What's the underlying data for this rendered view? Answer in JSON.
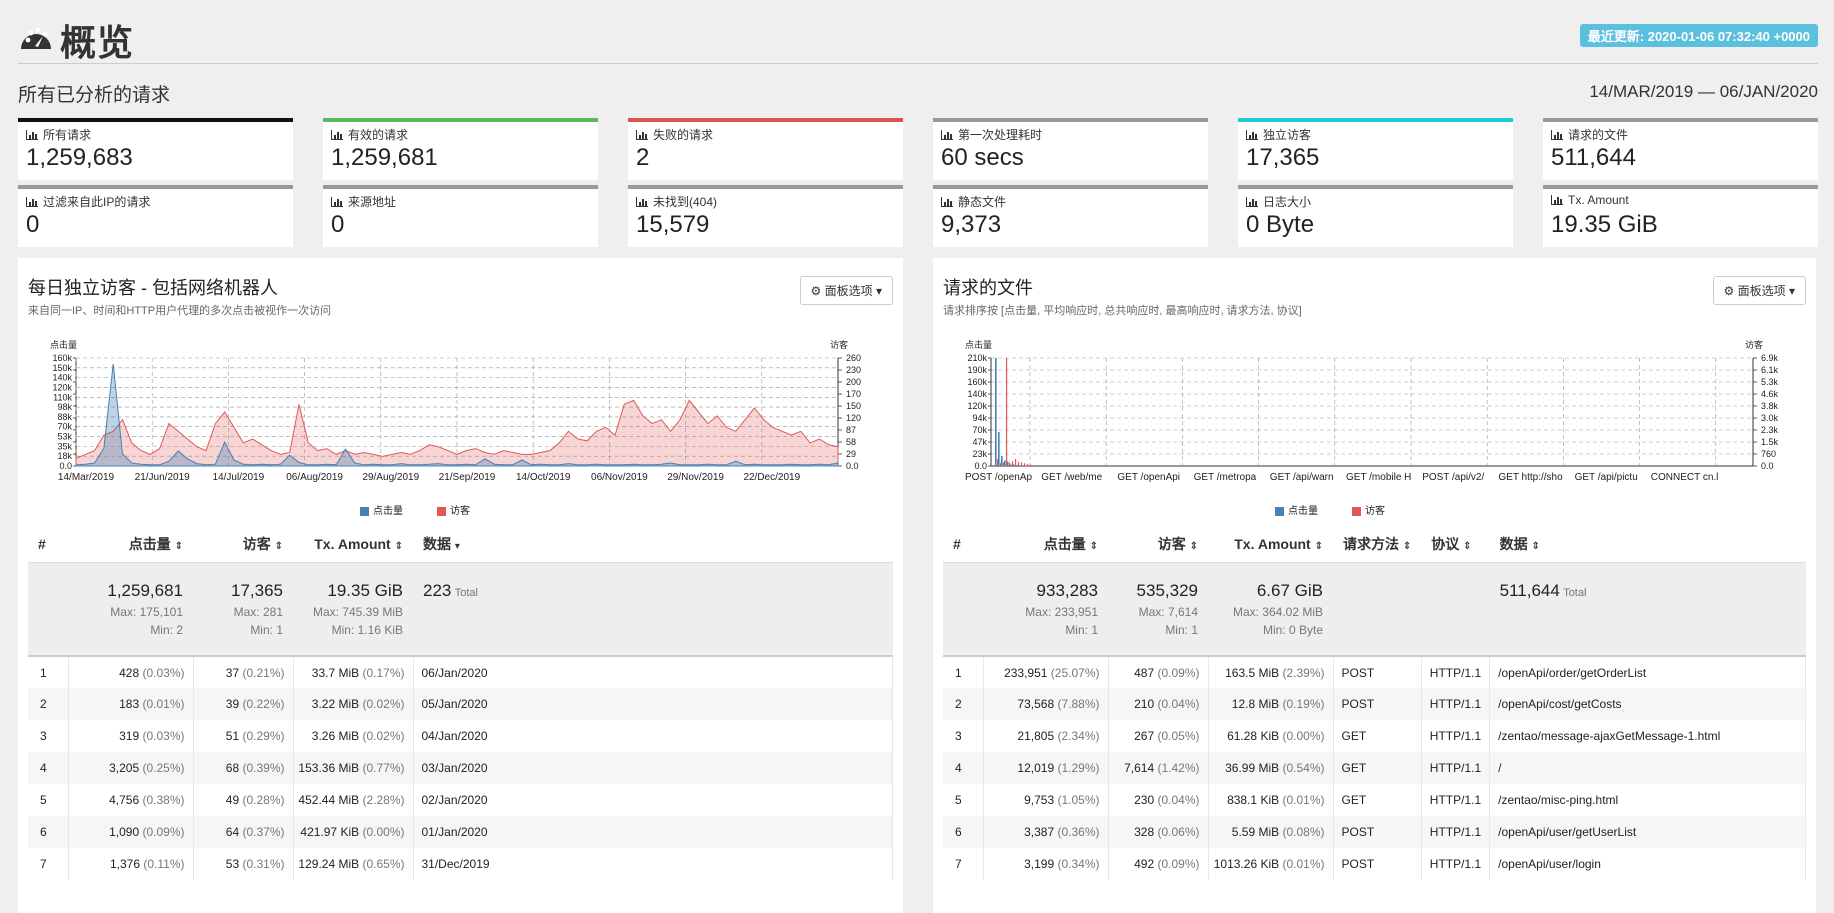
{
  "header": {
    "title": "概览",
    "updated": "最近更新: 2020-01-06 07:32:40 +0000"
  },
  "overview": {
    "subtitle": "所有已分析的请求",
    "daterange": "14/MAR/2019 — 06/JAN/2020"
  },
  "cards": [
    {
      "label": "所有请求",
      "value": "1,259,683",
      "color": "#111111"
    },
    {
      "label": "有效的请求",
      "value": "1,259,681",
      "color": "#5cb85c"
    },
    {
      "label": "失败的请求",
      "value": "2",
      "color": "#d9534f"
    },
    {
      "label": "第一次处理耗时",
      "value": "60 secs",
      "color": "#999999"
    },
    {
      "label": "独立访客",
      "value": "17,365",
      "color": "#1ec9d6"
    },
    {
      "label": "请求的文件",
      "value": "511,644",
      "color": "#999999"
    },
    {
      "label": "过滤来自此IP的请求",
      "value": "0",
      "color": "#999999"
    },
    {
      "label": "来源地址",
      "value": "0",
      "color": "#999999"
    },
    {
      "label": "未找到(404)",
      "value": "15,579",
      "color": "#999999"
    },
    {
      "label": "静态文件",
      "value": "9,373",
      "color": "#999999"
    },
    {
      "label": "日志大小",
      "value": "0 Byte",
      "color": "#999999"
    },
    {
      "label": "Tx. Amount",
      "value": "19.35 GiB",
      "color": "#999999"
    }
  ],
  "panel_left": {
    "title": "每日独立访客 - 包括网络机器人",
    "subtitle": "来自同一IP、时间和HTTP用户代理的多次点击被视作一次访问",
    "options": "面板选项",
    "columns": [
      "#",
      "点击量",
      "访客",
      "Tx. Amount",
      "数据"
    ],
    "totals": {
      "hits": "1,259,681",
      "hits_max": "Max: 175,101",
      "hits_min": "Min: 2",
      "visitors": "17,365",
      "visitors_max": "Max: 281",
      "visitors_min": "Min: 1",
      "tx": "19.35 GiB",
      "tx_max": "Max: 745.39 MiB",
      "tx_min": "Min: 1.16 KiB",
      "data": "223",
      "data_label": "Total"
    },
    "rows": [
      {
        "i": "1",
        "hits": "428",
        "hits_p": "(0.03%)",
        "vis": "37",
        "vis_p": "(0.21%)",
        "tx": "33.7 MiB",
        "tx_p": "(0.17%)",
        "data": "06/Jan/2020"
      },
      {
        "i": "2",
        "hits": "183",
        "hits_p": "(0.01%)",
        "vis": "39",
        "vis_p": "(0.22%)",
        "tx": "3.22 MiB",
        "tx_p": "(0.02%)",
        "data": "05/Jan/2020"
      },
      {
        "i": "3",
        "hits": "319",
        "hits_p": "(0.03%)",
        "vis": "51",
        "vis_p": "(0.29%)",
        "tx": "3.26 MiB",
        "tx_p": "(0.02%)",
        "data": "04/Jan/2020"
      },
      {
        "i": "4",
        "hits": "3,205",
        "hits_p": "(0.25%)",
        "vis": "68",
        "vis_p": "(0.39%)",
        "tx": "153.36 MiB",
        "tx_p": "(0.77%)",
        "data": "03/Jan/2020"
      },
      {
        "i": "5",
        "hits": "4,756",
        "hits_p": "(0.38%)",
        "vis": "49",
        "vis_p": "(0.28%)",
        "tx": "452.44 MiB",
        "tx_p": "(2.28%)",
        "data": "02/Jan/2020"
      },
      {
        "i": "6",
        "hits": "1,090",
        "hits_p": "(0.09%)",
        "vis": "64",
        "vis_p": "(0.37%)",
        "tx": "421.97 KiB",
        "tx_p": "(0.00%)",
        "data": "01/Jan/2020"
      },
      {
        "i": "7",
        "hits": "1,376",
        "hits_p": "(0.11%)",
        "vis": "53",
        "vis_p": "(0.31%)",
        "tx": "129.24 MiB",
        "tx_p": "(0.65%)",
        "data": "31/Dec/2019"
      }
    ]
  },
  "panel_right": {
    "title": "请求的文件",
    "subtitle": "请求排序按 [点击量, 平均响应时, 总共响应时, 最高响应时, 请求方法, 协议]",
    "options": "面板选项",
    "columns": [
      "#",
      "点击量",
      "访客",
      "Tx. Amount",
      "请求方法",
      "协议",
      "数据"
    ],
    "totals": {
      "hits": "933,283",
      "hits_max": "Max: 233,951",
      "hits_min": "Min: 1",
      "visitors": "535,329",
      "visitors_max": "Max: 7,614",
      "visitors_min": "Min: 1",
      "tx": "6.67 GiB",
      "tx_max": "Max: 364.02 MiB",
      "tx_min": "Min: 0 Byte",
      "data": "511,644",
      "data_label": "Total"
    },
    "rows": [
      {
        "i": "1",
        "hits": "233,951",
        "hits_p": "(25.07%)",
        "vis": "487",
        "vis_p": "(0.09%)",
        "tx": "163.5 MiB",
        "tx_p": "(2.39%)",
        "method": "POST",
        "proto": "HTTP/1.1",
        "data": "/openApi/order/getOrderList"
      },
      {
        "i": "2",
        "hits": "73,568",
        "hits_p": "(7.88%)",
        "vis": "210",
        "vis_p": "(0.04%)",
        "tx": "12.8 MiB",
        "tx_p": "(0.19%)",
        "method": "POST",
        "proto": "HTTP/1.1",
        "data": "/openApi/cost/getCosts"
      },
      {
        "i": "3",
        "hits": "21,805",
        "hits_p": "(2.34%)",
        "vis": "267",
        "vis_p": "(0.05%)",
        "tx": "61.28 KiB",
        "tx_p": "(0.00%)",
        "method": "GET",
        "proto": "HTTP/1.1",
        "data": "/zentao/message-ajaxGetMessage-1.html"
      },
      {
        "i": "4",
        "hits": "12,019",
        "hits_p": "(1.29%)",
        "vis": "7,614",
        "vis_p": "(1.42%)",
        "tx": "36.99 MiB",
        "tx_p": "(0.54%)",
        "method": "GET",
        "proto": "HTTP/1.1",
        "data": "/"
      },
      {
        "i": "5",
        "hits": "9,753",
        "hits_p": "(1.05%)",
        "vis": "230",
        "vis_p": "(0.04%)",
        "tx": "838.1 KiB",
        "tx_p": "(0.01%)",
        "method": "GET",
        "proto": "HTTP/1.1",
        "data": "/zentao/misc-ping.html"
      },
      {
        "i": "6",
        "hits": "3,387",
        "hits_p": "(0.36%)",
        "vis": "328",
        "vis_p": "(0.06%)",
        "tx": "5.59 MiB",
        "tx_p": "(0.08%)",
        "method": "POST",
        "proto": "HTTP/1.1",
        "data": "/openApi/user/getUserList"
      },
      {
        "i": "7",
        "hits": "3,199",
        "hits_p": "(0.34%)",
        "vis": "492",
        "vis_p": "(0.09%)",
        "tx": "1013.26 KiB",
        "tx_p": "(0.01%)",
        "method": "POST",
        "proto": "HTTP/1.1",
        "data": "/openApi/user/login"
      }
    ]
  },
  "chart_data": [
    {
      "type": "area",
      "ylabel_left": "点击量",
      "ylabel_right": "访客",
      "left_ticks": [
        "160k",
        "150k",
        "140k",
        "120k",
        "110k",
        "98k",
        "88k",
        "70k",
        "53k",
        "35k",
        "18k",
        "0.0"
      ],
      "right_ticks": [
        "260",
        "230",
        "200",
        "170",
        "150",
        "120",
        "87",
        "58",
        "29",
        "0.0"
      ],
      "x_ticks": [
        "14/Mar/2019",
        "21/Jun/2019",
        "14/Jul/2019",
        "06/Aug/2019",
        "29/Aug/2019",
        "21/Sep/2019",
        "14/Oct/2019",
        "06/Nov/2019",
        "29/Nov/2019",
        "22/Dec/2019"
      ],
      "legend": [
        "点击量",
        "访客"
      ],
      "colors": {
        "hits": "#4682b4",
        "visitors": "#e05858"
      },
      "hits": [
        2,
        3,
        5,
        30,
        170,
        20,
        5,
        3,
        2,
        2,
        8,
        25,
        12,
        4,
        2,
        3,
        40,
        10,
        3,
        2,
        3,
        2,
        3,
        18,
        6,
        2,
        2,
        3,
        2,
        28,
        5,
        2,
        3,
        2,
        2,
        4,
        2,
        2,
        3,
        4,
        2,
        2,
        3,
        2,
        12,
        3,
        2,
        2,
        10,
        2,
        3,
        2,
        2,
        4,
        2,
        2,
        3,
        2,
        2,
        2,
        3,
        2,
        2,
        3,
        5,
        2,
        2,
        2,
        3,
        2,
        2,
        8,
        2,
        3,
        2,
        2,
        2,
        3,
        2,
        2,
        3,
        2,
        5
      ],
      "visitors": [
        20,
        30,
        40,
        80,
        90,
        120,
        60,
        40,
        30,
        45,
        110,
        90,
        70,
        50,
        40,
        110,
        140,
        100,
        60,
        70,
        55,
        40,
        30,
        35,
        160,
        60,
        40,
        45,
        30,
        40,
        30,
        35,
        30,
        25,
        30,
        35,
        30,
        40,
        55,
        50,
        40,
        30,
        40,
        45,
        35,
        30,
        40,
        35,
        30,
        30,
        35,
        40,
        60,
        90,
        70,
        65,
        90,
        100,
        80,
        160,
        170,
        130,
        110,
        120,
        90,
        120,
        170,
        140,
        110,
        130,
        100,
        90,
        120,
        150,
        120,
        100,
        90,
        80,
        90,
        60,
        70,
        55,
        50
      ]
    },
    {
      "type": "bar",
      "ylabel_left": "点击量",
      "ylabel_right": "访客",
      "left_ticks": [
        "210k",
        "190k",
        "160k",
        "140k",
        "120k",
        "94k",
        "70k",
        "47k",
        "23k",
        "0.0"
      ],
      "right_ticks": [
        "6.9k",
        "6.1k",
        "5.3k",
        "4.6k",
        "3.8k",
        "3.0k",
        "2.3k",
        "1.5k",
        "760",
        "0.0"
      ],
      "x_ticks": [
        "POST /openAp",
        "GET /web/me",
        "GET /openApi",
        "GET /metropa",
        "GET /api/warn",
        "GET /mobile H",
        "POST /api/v2/",
        "GET http://sho",
        "GET /api/pictu",
        "CONNECT cn.l"
      ],
      "legend": [
        "点击量",
        "访客"
      ],
      "colors": {
        "hits": "#4682b4",
        "visitors": "#e05858"
      },
      "hits": [
        234000,
        73600,
        21800,
        12000,
        9750,
        3390,
        3200,
        2000,
        1500,
        1000,
        800,
        600
      ],
      "visitors": [
        487,
        210,
        267,
        7614,
        230,
        328,
        492,
        300,
        250,
        200,
        150,
        100
      ]
    }
  ]
}
